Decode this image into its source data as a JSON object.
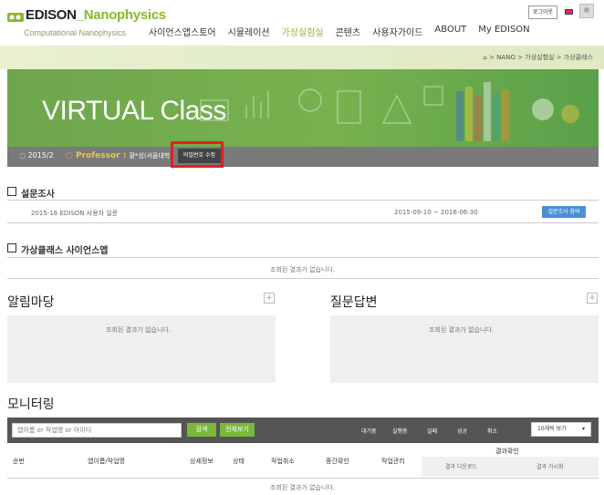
{
  "header": {
    "logo_main": "EDISON",
    "logo_accent": "_Nanophysics",
    "logo_sub": "Computational  Nanophysics",
    "nav": [
      "사이언스앱스토어",
      "시뮬레이션",
      "가상실험실",
      "콘텐츠",
      "사용자가이드",
      "ABOUT",
      "My EDISON"
    ],
    "active_nav_index": 2,
    "login_label": "로그아웃",
    "accent_color": "#8bb82a"
  },
  "breadcrumb": {
    "home_icon": "home-icon",
    "text": "> NANO > 가상실험실 > 가상클래스"
  },
  "banner": {
    "title": "VIRTUAL Class",
    "semester": "2015/2",
    "professor_label": "Professor :",
    "professor_name": "황*성(서울대학",
    "password_button": "비밀번호 수정",
    "highlight_color": "#e02020"
  },
  "survey": {
    "title": "설문조사",
    "name": "2015-16 EDISON 사용자 설문",
    "date_range": "2015-09-10 ~ 2016-06-30",
    "button": "설문조사 참여"
  },
  "science_apps": {
    "title": "가상클래스 사이언스앱",
    "empty": "조회된 결과가 없습니다."
  },
  "notice": {
    "title": "알림마당",
    "empty": "조회된 결과가 없습니다.",
    "more": "+"
  },
  "qna": {
    "title": "질문답변",
    "empty": "조회된 결과가 없습니다.",
    "more": "+"
  },
  "monitoring": {
    "title": "모니터링",
    "search_placeholder": "앱이름 or 작업명 or 아이디",
    "search_button": "검색",
    "all_button": "전체보기",
    "status_tabs": [
      "대기중",
      "실행중",
      "실패",
      "성공",
      "취소"
    ],
    "per_page": "10개씩 보기",
    "columns": [
      "순번",
      "앱이름/작업명",
      "상세정보",
      "상태",
      "작업취소",
      "중간확인",
      "작업관리"
    ],
    "result_group": "결과확인",
    "result_sub": [
      "결과 다운로드",
      "결과 가시화"
    ],
    "empty": "조회된 결과가 없습니다."
  }
}
